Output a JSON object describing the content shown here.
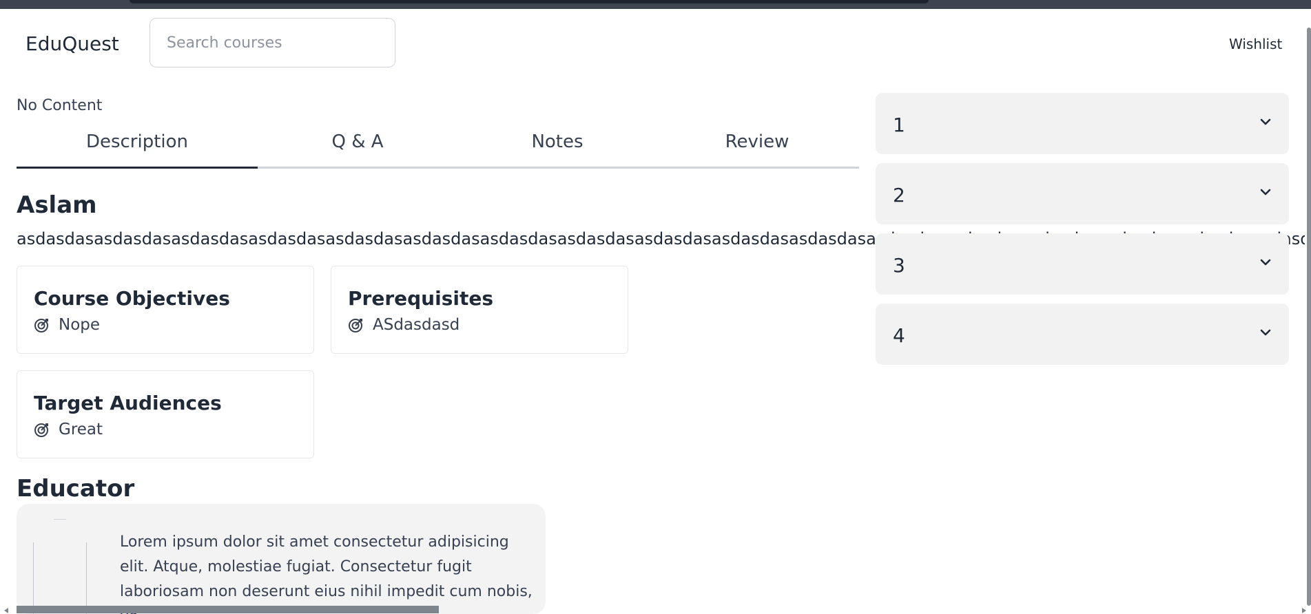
{
  "header": {
    "brand": "EduQuest",
    "search_placeholder": "Search courses",
    "wishlist_label": "Wishlist"
  },
  "content": {
    "no_content_text": "No Content",
    "tabs": [
      {
        "label": "Description",
        "active": true
      },
      {
        "label": "Q & A",
        "active": false
      },
      {
        "label": "Notes",
        "active": false
      },
      {
        "label": "Review",
        "active": false
      }
    ],
    "course_title": "Aslam",
    "course_description": "asdasdasasdasdasasdasdasasdasdasasdasdasasdasdasasdasdasasdasdasasdasdasasdasdasasdasdasasdasdasasdasdasasdasdasasdasdasasdasdasasdasdasasdasdasasdasdasasdasdasasdasdasasdasdasasdasdasasdasdasasdasdasasdasdasasdasdasasdasdasasdasdasasdasdasasdasdasasdasda",
    "cards": [
      {
        "title": "Course Objectives",
        "item": "Nope",
        "icon": "target-icon"
      },
      {
        "title": "Prerequisites",
        "item": "ASdasdasd",
        "icon": "target-icon"
      },
      {
        "title": "Target Audiences",
        "item": "Great",
        "icon": "target-icon"
      }
    ],
    "educator_heading": "Educator",
    "educator_bio": "Lorem ipsum dolor sit amet consectetur adipisicing elit. Atque, molestiae fugiat. Consectetur fugit laboriosam non deserunt eius nihil impedit cum nobis, vo"
  },
  "sections": [
    {
      "label": "1",
      "icon": "chevron-down-icon"
    },
    {
      "label": "2",
      "icon": "chevron-down-icon"
    },
    {
      "label": "3",
      "icon": "chevron-down-icon"
    },
    {
      "label": "4",
      "icon": "chevron-down-icon"
    }
  ],
  "colors": {
    "text_primary": "#1f2937",
    "accordion_bg": "#f2f2f2",
    "tab_underline_active": "#1f2937",
    "top_bar": "#3f4451"
  }
}
